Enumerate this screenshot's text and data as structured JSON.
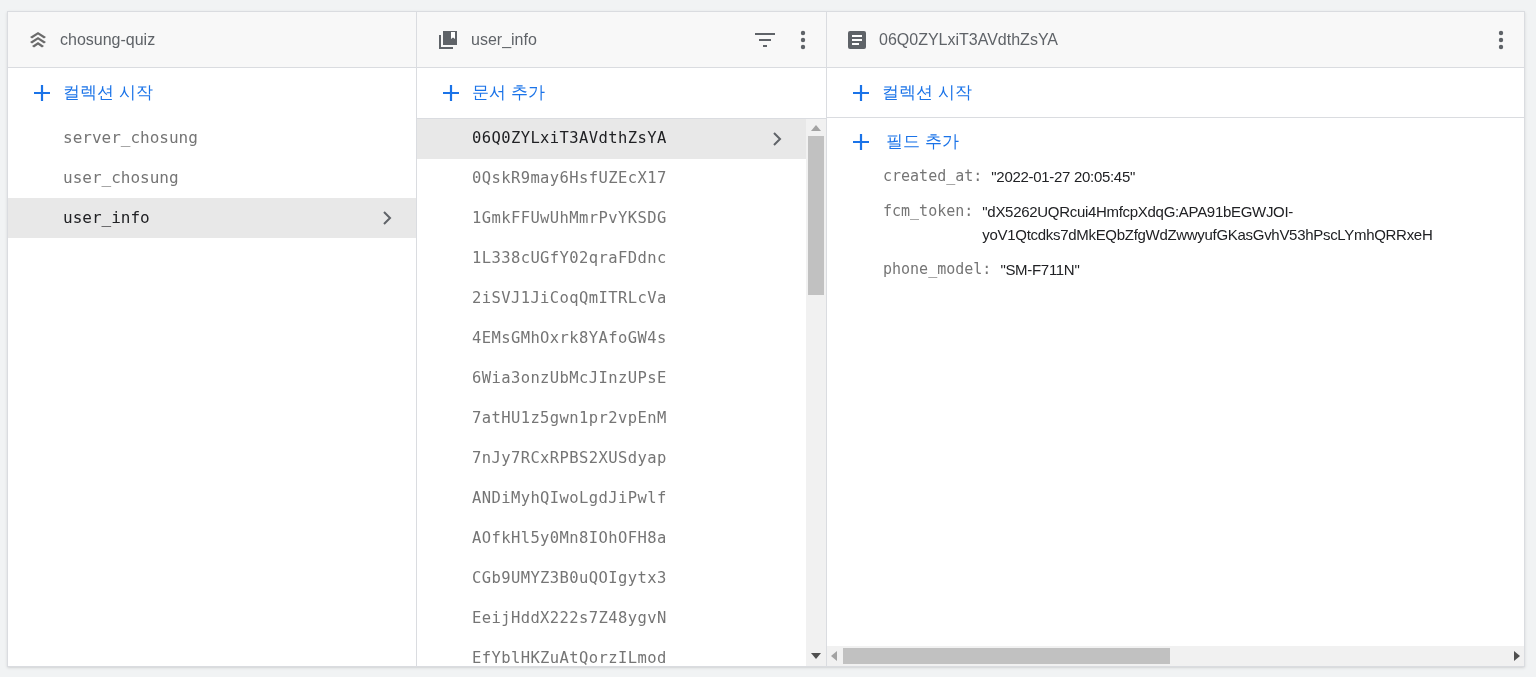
{
  "panels": [
    {
      "kind": "root",
      "title": "chosung-quiz",
      "add_label": "컬렉션 시작",
      "items": [
        {
          "label": "server_chosung",
          "selected": false
        },
        {
          "label": "user_chosung",
          "selected": false
        },
        {
          "label": "user_info",
          "selected": true
        }
      ]
    },
    {
      "kind": "collection",
      "title": "user_info",
      "add_label": "문서 추가",
      "items": [
        {
          "label": "06Q0ZYLxiT3AVdthZsYA",
          "selected": true
        },
        {
          "label": "0QskR9may6HsfUZEcX17",
          "selected": false
        },
        {
          "label": "1GmkFFUwUhMmrPvYKSDG",
          "selected": false
        },
        {
          "label": "1L338cUGfY02qraFDdnc",
          "selected": false
        },
        {
          "label": "2iSVJ1JiCoqQmITRLcVa",
          "selected": false
        },
        {
          "label": "4EMsGMhOxrk8YAfoGW4s",
          "selected": false
        },
        {
          "label": "6Wia3onzUbMcJInzUPsE",
          "selected": false
        },
        {
          "label": "7atHU1z5gwn1pr2vpEnM",
          "selected": false
        },
        {
          "label": "7nJy7RCxRPBS2XUSdyap",
          "selected": false
        },
        {
          "label": "ANDiMyhQIwoLgdJiPwlf",
          "selected": false
        },
        {
          "label": "AOfkHl5y0Mn8IOhOFH8a",
          "selected": false
        },
        {
          "label": "CGb9UMYZ3B0uQOIgytx3",
          "selected": false
        },
        {
          "label": "EeijHddX222s7Z48ygvN",
          "selected": false
        },
        {
          "label": "EfYblHKZuAtQorzILmod",
          "selected": false
        }
      ]
    },
    {
      "kind": "document",
      "title": "06Q0ZYLxiT3AVdthZsYA",
      "add_label": "컬렉션 시작",
      "add_field_label": "필드 추가",
      "fields": [
        {
          "key": "created_at:",
          "value_lines": [
            "\"2022-01-27 20:05:45\""
          ]
        },
        {
          "key": "fcm_token:",
          "value_lines": [
            "\"dX5262UQRcui4HmfcpXdqG:APA91bEGWJOI-",
            "yoV1Qtcdks7dMkEQbZfgWdZwwyufGKasGvhV53hPscLYmhQRRxeH"
          ]
        },
        {
          "key": "phone_model:",
          "value_lines": [
            "\"SM-F711N\""
          ]
        }
      ]
    }
  ]
}
